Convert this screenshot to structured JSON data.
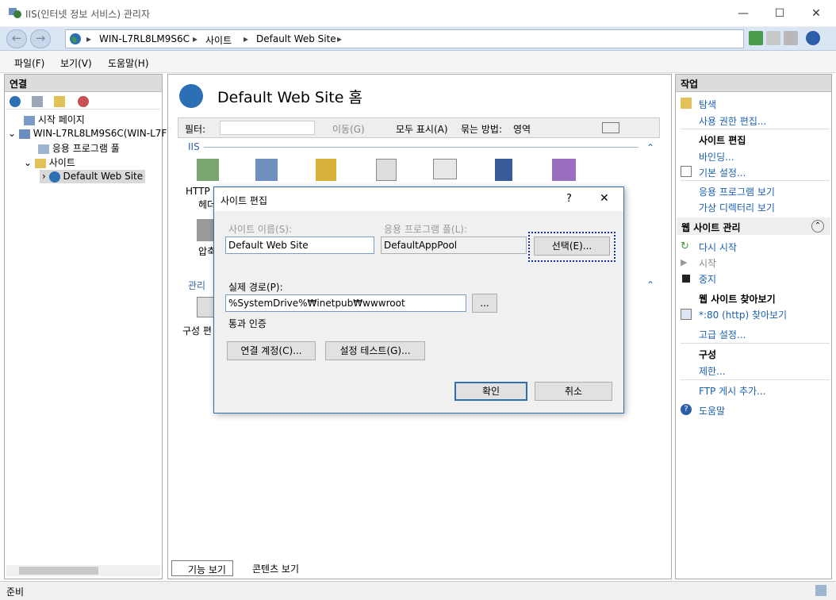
{
  "window": {
    "title": "IIS(인터넷 정보 서비스) 관리자",
    "min": "—",
    "max": "☐",
    "close": "✕"
  },
  "address": {
    "back": "←",
    "forward": "→",
    "crumbs": [
      "WIN-L7RL8LM9S6C",
      "사이트",
      "Default Web Site"
    ],
    "sep": "▸"
  },
  "menu": [
    "파일(F)",
    "보기(V)",
    "도움말(H)"
  ],
  "connections": {
    "header": "연결",
    "tree": {
      "start": "시작 페이지",
      "server": "WIN-L7RL8LM9S6C(WIN-L7F",
      "apppools": "응용 프로그램 풀",
      "sites": "사이트",
      "site": "Default Web Site"
    }
  },
  "center": {
    "title": "Default Web Site 홈",
    "filter_label": "필터:",
    "go_label": "이동(G)",
    "showall_label": "모두 표시(A)",
    "groupby_label": "묶는 방법:",
    "groupby_value": "영역",
    "section_iis": "IIS",
    "section_mgmt": "관리",
    "icon_labels": [
      "HTTP",
      "헤더",
      "압축",
      "구성 편"
    ],
    "tab_features": "기능 보기",
    "tab_content": "콘텐츠 보기"
  },
  "actions": {
    "header": "작업",
    "explore": "탐색",
    "edit_perms": "사용 권한 편집...",
    "edit_site": "사이트 편집",
    "bindings": "바인딩...",
    "basic_settings": "기본 설정...",
    "view_apps": "응용 프로그램 보기",
    "view_vdirs": "가상 디렉터리 보기",
    "manage_site": "웹 사이트 관리",
    "restart": "다시 시작",
    "start": "시작",
    "stop": "중지",
    "browse_site": "웹 사이트 찾아보기",
    "browse_80": "*:80 (http) 찾아보기",
    "advanced": "고급 설정...",
    "configure": "구성",
    "limits": "제한...",
    "add_ftp": "FTP 게시 추가...",
    "help": "도움말"
  },
  "status": {
    "text": "준비"
  },
  "dialog": {
    "title": "사이트 편집",
    "help": "?",
    "close": "✕",
    "site_name_label": "사이트 이름(S):",
    "site_name_value": "Default Web Site",
    "app_pool_label": "응용 프로그램 풀(L):",
    "app_pool_value": "DefaultAppPool",
    "select_button": "선택(E)...",
    "physical_path_label": "실제 경로(P):",
    "physical_path_value": "%SystemDrive%₩inetpub₩wwwroot",
    "browse_button": "...",
    "passthrough_label": "통과 인증",
    "connect_as_button": "연결 계정(C)...",
    "test_settings_button": "설정 테스트(G)...",
    "ok_button": "확인",
    "cancel_button": "취소"
  },
  "colors": {
    "accent": "#2f6fb0",
    "link": "#1a5fb4",
    "address_bg": "#dbe6f4"
  }
}
